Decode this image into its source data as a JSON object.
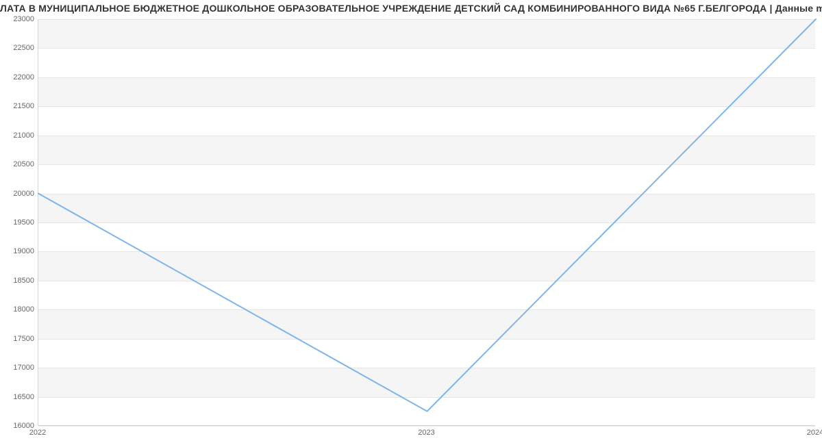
{
  "chart_data": {
    "type": "line",
    "title": "ЛАТА В МУНИЦИПАЛЬНОЕ БЮДЖЕТНОЕ ДОШКОЛЬНОЕ ОБРАЗОВАТЕЛЬНОЕ УЧРЕЖДЕНИЕ ДЕТСКИЙ САД КОМБИНИРОВАННОГО ВИДА №65 Г.БЕЛГОРОДА | Данные mnogo",
    "xlabel": "",
    "ylabel": "",
    "x": [
      "2022",
      "2023",
      "2024"
    ],
    "values": [
      20000,
      16250,
      23000
    ],
    "y_ticks": [
      16000,
      16500,
      17000,
      17500,
      18000,
      18500,
      19000,
      19500,
      20000,
      20500,
      21000,
      21500,
      22000,
      22500,
      23000
    ],
    "ylim": [
      16000,
      23000
    ],
    "line_color": "#7cb5ec"
  }
}
